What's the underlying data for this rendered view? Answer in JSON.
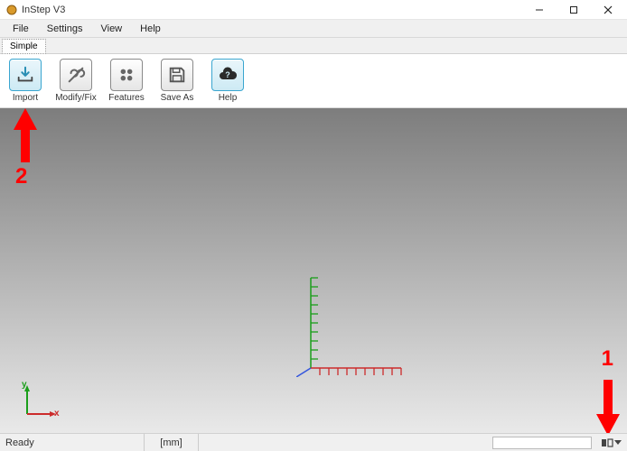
{
  "window": {
    "title": "InStep V3"
  },
  "menu": {
    "file": "File",
    "settings": "Settings",
    "view": "View",
    "help": "Help"
  },
  "tabs": {
    "simple": "Simple"
  },
  "toolbar": {
    "import": "Import",
    "modifyfix": "Modify/Fix",
    "features": "Features",
    "saveas": "Save As",
    "help": "Help"
  },
  "status": {
    "ready": "Ready",
    "units": "[mm]"
  },
  "axes": {
    "y": "y",
    "x": "x"
  },
  "annotations": {
    "one": "1",
    "two": "2"
  }
}
